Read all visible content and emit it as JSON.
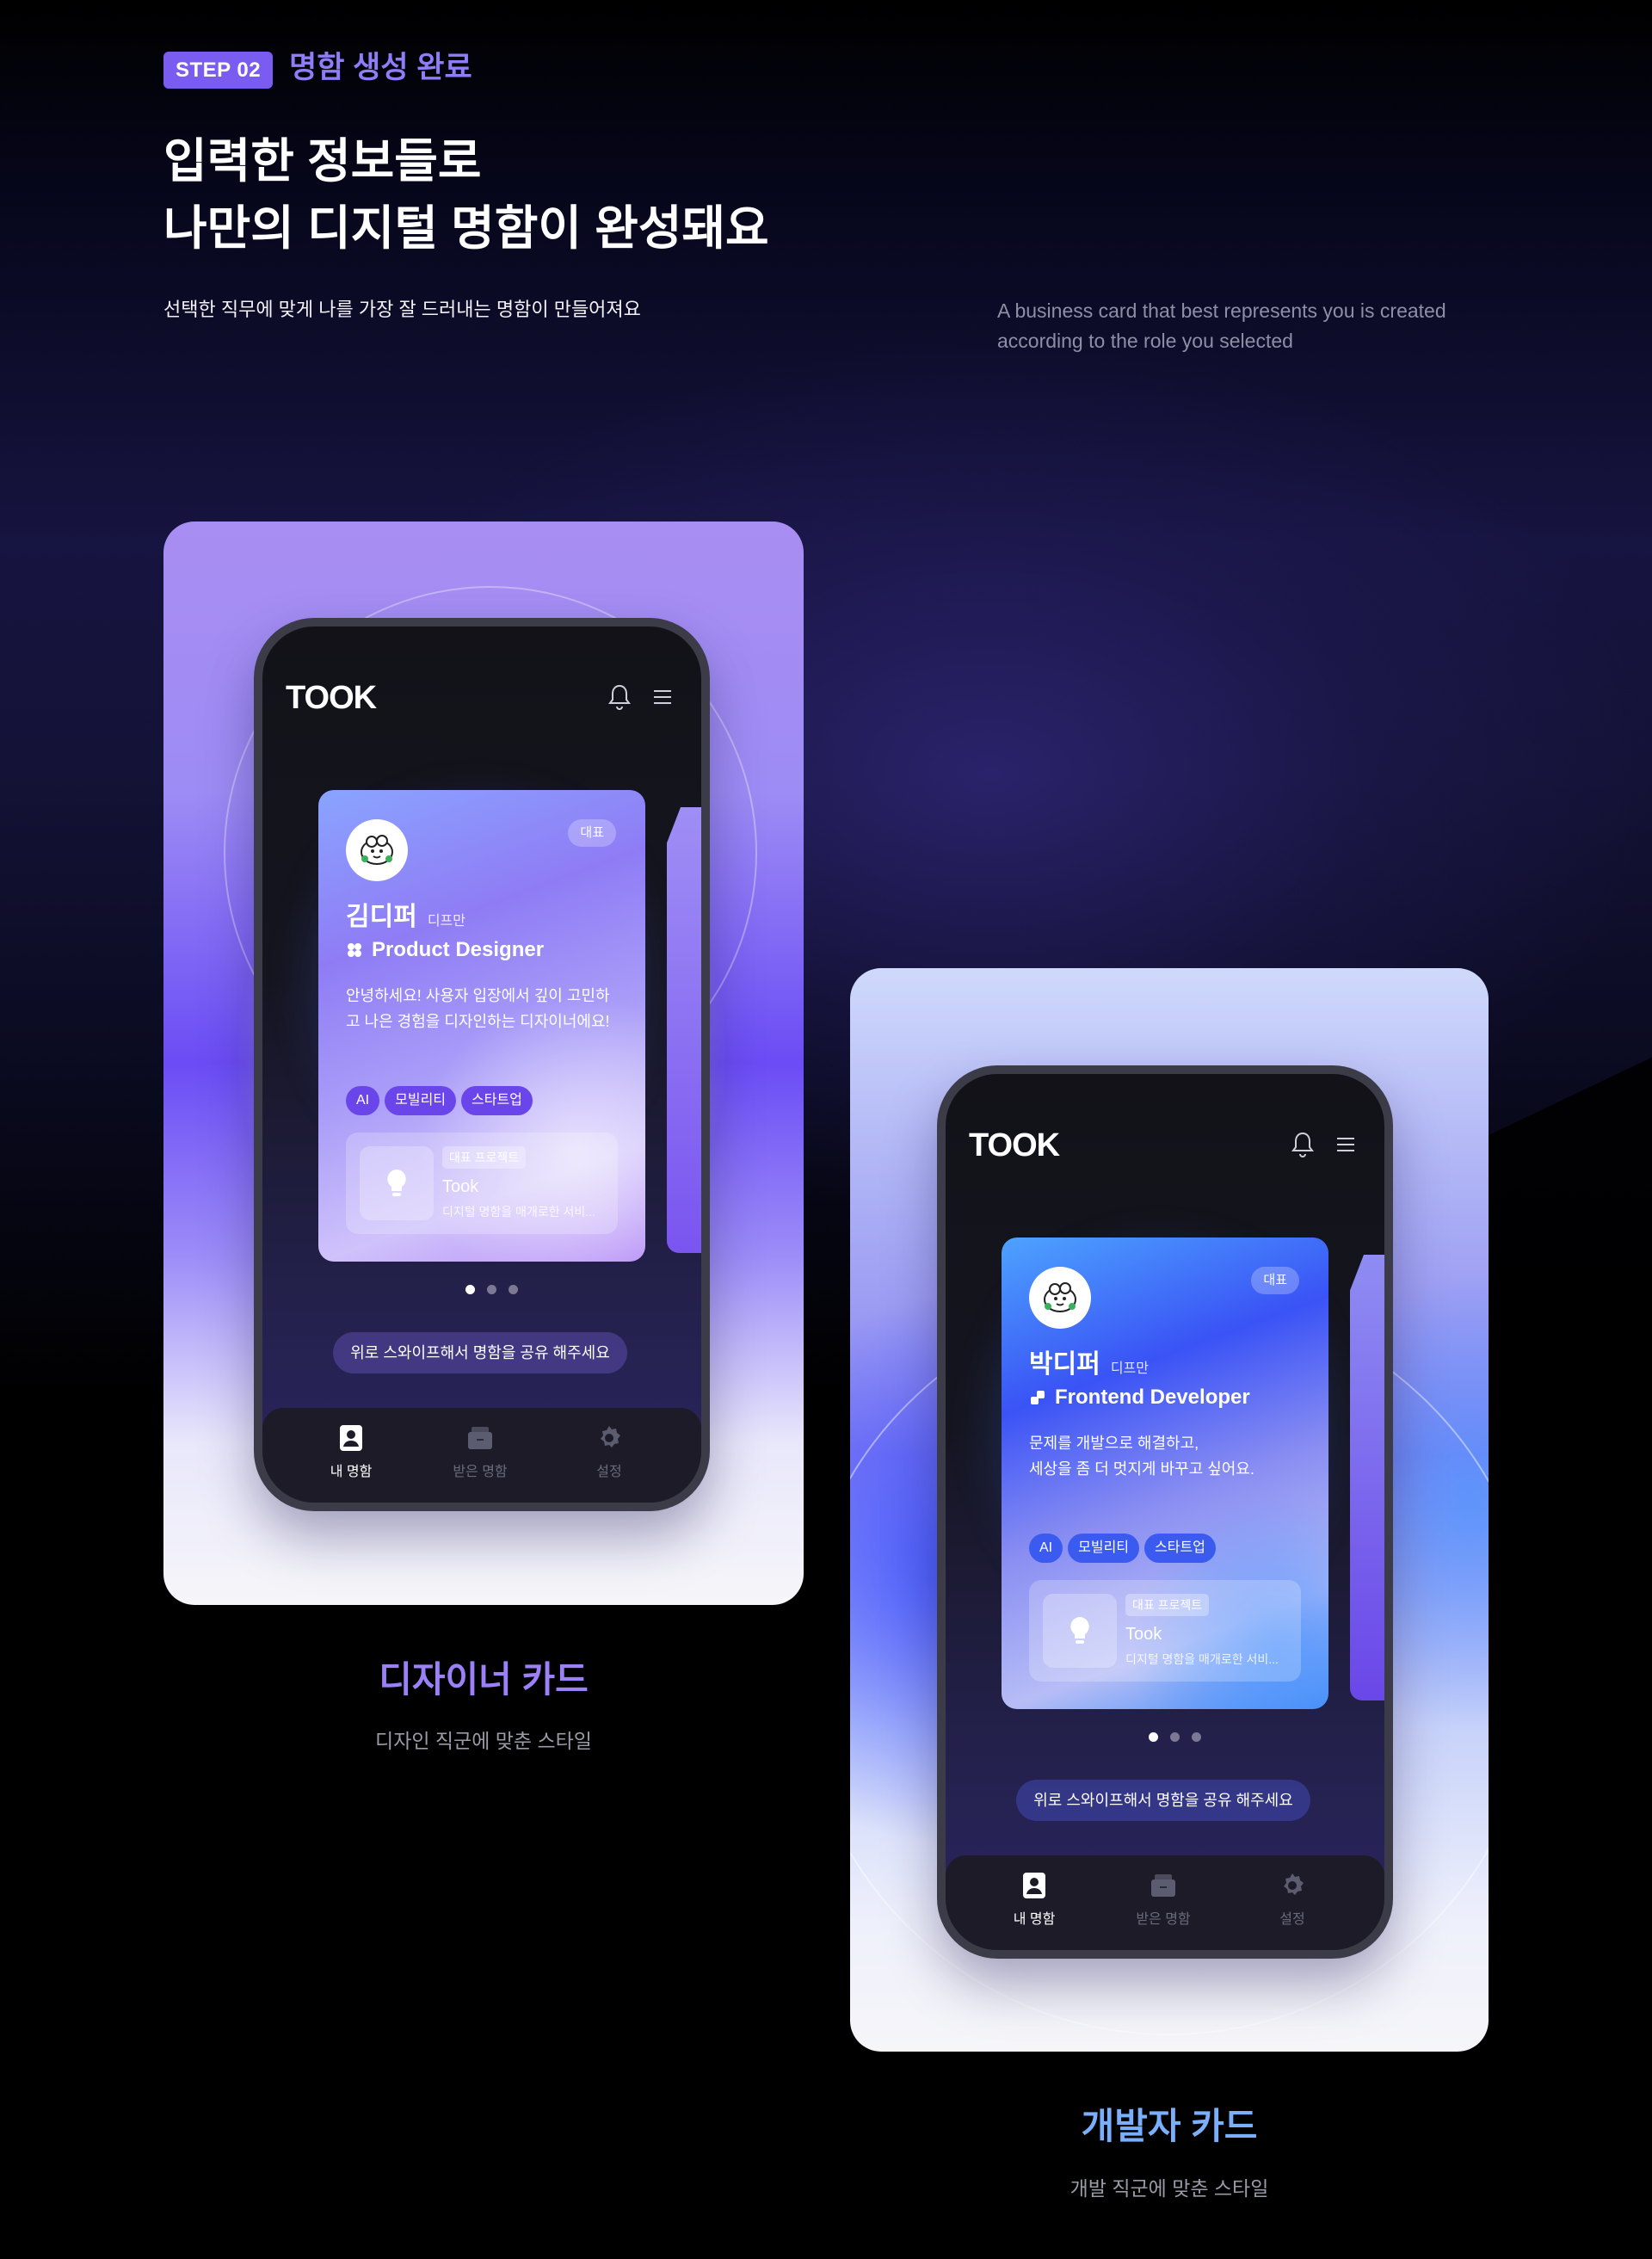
{
  "header": {
    "step_badge": "STEP 02",
    "step_label": "명함 생성 완료",
    "headline_line1": "입력한 정보들로",
    "headline_line2": "나만의 디지털 명함이 완성돼요",
    "subtext_ko": "선택한 직무에 맞게 나를 가장 잘 드러내는 명함이 만들어져요",
    "subtext_en": "A business card that best represents you is created according to the role you selected"
  },
  "app": {
    "logo": "TOOK",
    "swipe_hint": "위로 스와이프해서 명함을 공유 해주세요",
    "tabs": [
      {
        "label": "내 명함",
        "icon": "contact-card-icon"
      },
      {
        "label": "받은 명함",
        "icon": "card-box-icon"
      },
      {
        "label": "설정",
        "icon": "gear-icon"
      }
    ]
  },
  "designer_card": {
    "rep_badge": "대표",
    "name": "김디퍼",
    "nickname": "디프만",
    "role": "Product Designer",
    "bio": "안녕하세요! 사용자 입장에서 깊이 고민하고 나은 경험을 디자인하는 디자이너에요!",
    "tags": [
      "AI",
      "모빌리티",
      "스타트업"
    ],
    "project_badge": "대표 프로젝트",
    "project_name": "Took",
    "project_desc": "디지털 명함을 매개로한 서비...",
    "caption_title": "디자이너 카드",
    "caption_sub": "디자인 직군에 맞춘 스타일"
  },
  "developer_card": {
    "rep_badge": "대표",
    "name": "박디퍼",
    "nickname": "디프만",
    "role": "Frontend Developer",
    "bio_line1": "문제를 개발으로 해결하고,",
    "bio_line2": "세상을 좀 더 멋지게 바꾸고 싶어요.",
    "tags": [
      "AI",
      "모빌리티",
      "스타트업"
    ],
    "project_badge": "대표 프로젝트",
    "project_name": "Took",
    "project_desc": "디지털 명함을 매개로한 서비...",
    "caption_title": "개발자 카드",
    "caption_sub": "개발 직군에 맞춘 스타일"
  },
  "colors": {
    "accent_purple": "#7a5cf0",
    "step_label": "#8f7df7",
    "designer_caption": "#9b80f7",
    "developer_caption": "#7ab0fb"
  }
}
